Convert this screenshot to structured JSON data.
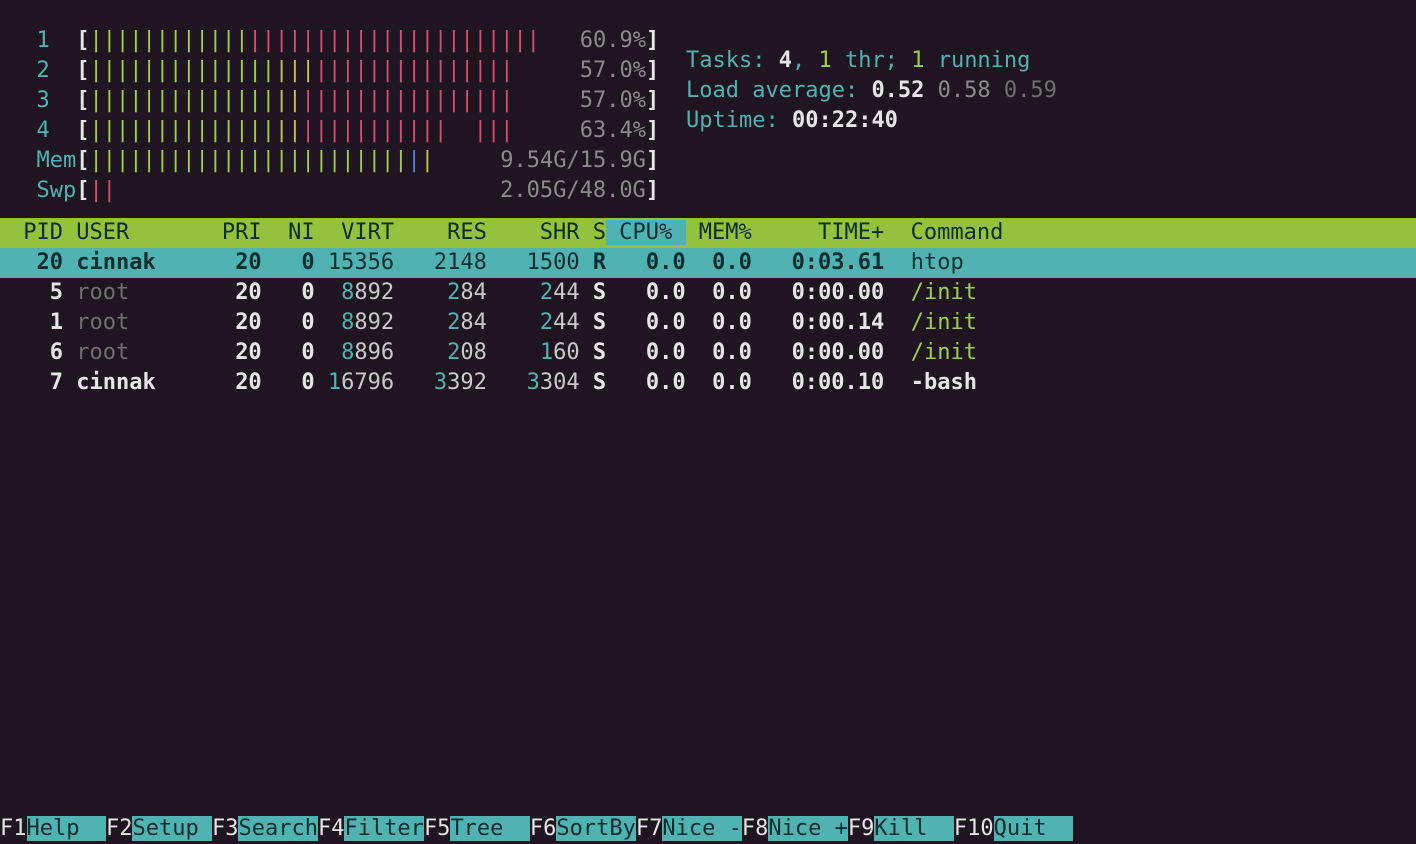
{
  "cpuMeters": [
    {
      "id": "1",
      "pct": "60.9%",
      "greenBars": 12,
      "yellowBars": 0,
      "redBars": 22
    },
    {
      "id": "2",
      "pct": "57.0%",
      "greenBars": 14,
      "yellowBars": 3,
      "redBars": 15
    },
    {
      "id": "3",
      "pct": "57.0%",
      "greenBars": 14,
      "yellowBars": 2,
      "redBars": 16
    },
    {
      "id": "4",
      "pct": "63.4%",
      "greenBars": 14,
      "yellowBars": 2,
      "redBars": 11,
      "tailRed": 3
    }
  ],
  "mem": {
    "label": "Mem",
    "text": "9.54G/15.9G",
    "greenBars": 24,
    "blueBars": 1,
    "yellowBars": 1
  },
  "swp": {
    "label": "Swp",
    "text": "2.05G/48.0G",
    "redBars": 2
  },
  "tasks": {
    "label": "Tasks: ",
    "count": "4",
    "sep": ", ",
    "thr": "1",
    "thrLbl": " thr; ",
    "run": "1",
    "runLbl": " running"
  },
  "load": {
    "label": "Load average: ",
    "v1": "0.52",
    "v2": "0.58",
    "v3": "0.59"
  },
  "uptime": {
    "label": "Uptime: ",
    "value": "00:22:40"
  },
  "columns": {
    "pid": " PID",
    "user": "USER    ",
    "pri": "  PRI",
    "ni": "  NI",
    "virt": "  VIRT",
    "res": "   RES",
    "shr": "   SHR",
    "s": "S",
    "cpu": " CPU%",
    "mem": " MEM%",
    "time": "    TIME+",
    "cmd": "  Command"
  },
  "rows": [
    {
      "selected": true,
      "pid": "20",
      "user": "cinnak",
      "pri": "20",
      "ni": "0",
      "virt": "15356",
      "res": "2148",
      "shr": "1500",
      "s": "R",
      "cpu": "0.0",
      "mem": "0.0",
      "time": "0:03.61",
      "cmdGreen": "htop",
      "cmdRest": ""
    },
    {
      "selected": false,
      "pid": "5",
      "user": "root",
      "pri": "20",
      "ni": "0",
      "virt": "8892",
      "res": "284",
      "shr": "244",
      "s": "S",
      "cpu": "0.0",
      "mem": "0.0",
      "time": "0:00.00",
      "cmdGreen": "/init",
      "cmdRest": "",
      "dimUser": true
    },
    {
      "selected": false,
      "pid": "1",
      "user": "root",
      "pri": "20",
      "ni": "0",
      "virt": "8892",
      "res": "284",
      "shr": "244",
      "s": "S",
      "cpu": "0.0",
      "mem": "0.0",
      "time": "0:00.14",
      "cmdGreen": "/init",
      "cmdRest": "",
      "dimUser": true
    },
    {
      "selected": false,
      "pid": "6",
      "user": "root",
      "pri": "20",
      "ni": "0",
      "virt": "8896",
      "res": "208",
      "shr": "160",
      "s": "S",
      "cpu": "0.0",
      "mem": "0.0",
      "time": "0:00.00",
      "cmdGreen": "/init",
      "cmdRest": "",
      "dimUser": true
    },
    {
      "selected": false,
      "pid": "7",
      "user": "cinnak",
      "pri": "20",
      "ni": "0",
      "virt": "16796",
      "res": "3392",
      "shr": "3304",
      "s": "S",
      "cpu": "0.0",
      "mem": "0.0",
      "time": "0:00.10",
      "cmdRest": "-bash"
    }
  ],
  "fkeys": [
    {
      "key": "F1",
      "label": "Help  "
    },
    {
      "key": "F2",
      "label": "Setup "
    },
    {
      "key": "F3",
      "label": "Search"
    },
    {
      "key": "F4",
      "label": "Filter"
    },
    {
      "key": "F5",
      "label": "Tree  "
    },
    {
      "key": "F6",
      "label": "SortBy"
    },
    {
      "key": "F7",
      "label": "Nice -"
    },
    {
      "key": "F8",
      "label": "Nice +"
    },
    {
      "key": "F9",
      "label": "Kill  "
    },
    {
      "key": "F10",
      "label": "Quit  "
    }
  ]
}
